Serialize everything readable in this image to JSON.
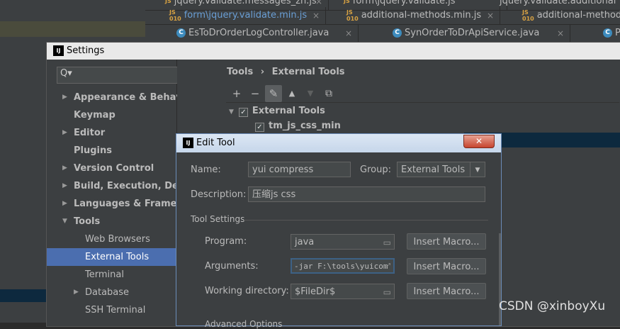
{
  "editor_tabs": {
    "row1": [
      {
        "label": "jquery.validate.messages_zh.js"
      },
      {
        "label": "form\\jquery.validate.min.js",
        "active": true
      },
      {
        "label": "additional-methods.min.js"
      },
      {
        "label": "additional-methods.js"
      }
    ],
    "row2": [
      {
        "label": "EsToDrOrderLogController.java"
      },
      {
        "label": "SynOrderToDrApiService.java"
      },
      {
        "label": "P"
      }
    ],
    "js_icon": "js-file-icon",
    "java_icon": "java-class-icon"
  },
  "settings": {
    "title": "Settings",
    "search_placeholder": "Q▾",
    "nav": [
      {
        "label": "Appearance & Behavior",
        "expandable": true
      },
      {
        "label": "Keymap"
      },
      {
        "label": "Editor",
        "expandable": true
      },
      {
        "label": "Plugins"
      },
      {
        "label": "Version Control",
        "expandable": true
      },
      {
        "label": "Build, Execution, Deploy",
        "expandable": true
      },
      {
        "label": "Languages & Framewor",
        "expandable": true
      },
      {
        "label": "Tools",
        "expanded": true
      },
      {
        "label": "Web Browsers",
        "sub": true
      },
      {
        "label": "External Tools",
        "sub": true,
        "selected": true
      },
      {
        "label": "Terminal",
        "sub": true
      },
      {
        "label": "Database",
        "sub": true,
        "expandable": true
      },
      {
        "label": "SSH Terminal",
        "sub": true
      }
    ],
    "breadcrumb": {
      "root": "Tools",
      "sep": "›",
      "leaf": "External Tools"
    },
    "toolbar": [
      "+",
      "−",
      "✎",
      "▲",
      "▼",
      "⧉"
    ],
    "tree": {
      "group": "External Tools",
      "item": "tm_js_css_min"
    }
  },
  "edit_tool": {
    "title": "Edit Tool",
    "close_label": "✕",
    "name_label": "Name:",
    "name_value": "yui compress",
    "group_label": "Group:",
    "group_value": "External Tools",
    "description_label": "Description:",
    "description_value": "压缩js css",
    "section_label": "Tool Settings",
    "program_label": "Program:",
    "program_value": "java",
    "arguments_label": "Arguments:",
    "arguments_value": "-jar F:\\tools\\yuicom",
    "workdir_label": "Working directory:",
    "workdir_value": "$FileDir$",
    "insert_macro_label": "Insert Macro...",
    "advanced_label": "Advanced Options"
  },
  "watermark": "CSDN @xinboyXu",
  "colors": {
    "selection": "#4b6eaf",
    "background": "#3c3f41"
  }
}
